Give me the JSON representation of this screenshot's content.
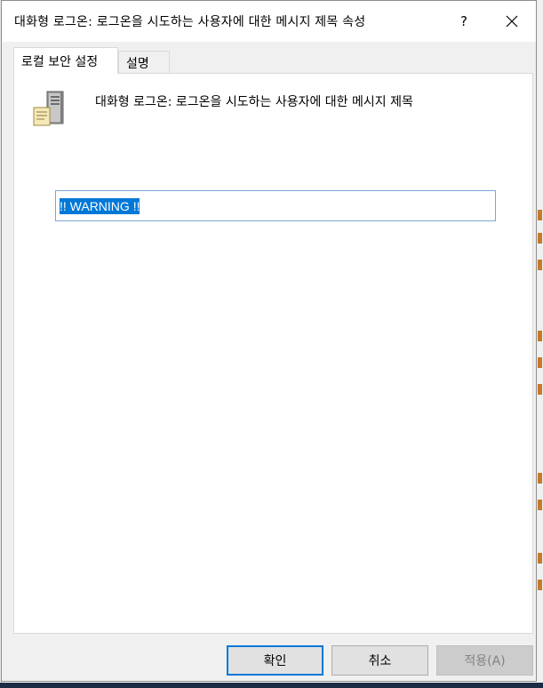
{
  "window": {
    "title": "대화형 로그온: 로그온을 시도하는 사용자에 대한 메시지 제목 속성",
    "help_label": "?",
    "close_icon": "close-icon"
  },
  "tabs": [
    {
      "label": "로컬 보안 설정",
      "active": true
    },
    {
      "label": "설명",
      "active": false
    }
  ],
  "policy": {
    "icon": "server-policy-icon",
    "name": "대화형 로그온: 로그온을 시도하는 사용자에 대한 메시지 제목"
  },
  "value_field": {
    "value": "!! WARNING !!"
  },
  "buttons": {
    "ok": "확인",
    "cancel": "취소",
    "apply": "적용(A)"
  },
  "colors": {
    "selection": "#0078d7",
    "dialog_bg": "#f0f0f0"
  }
}
